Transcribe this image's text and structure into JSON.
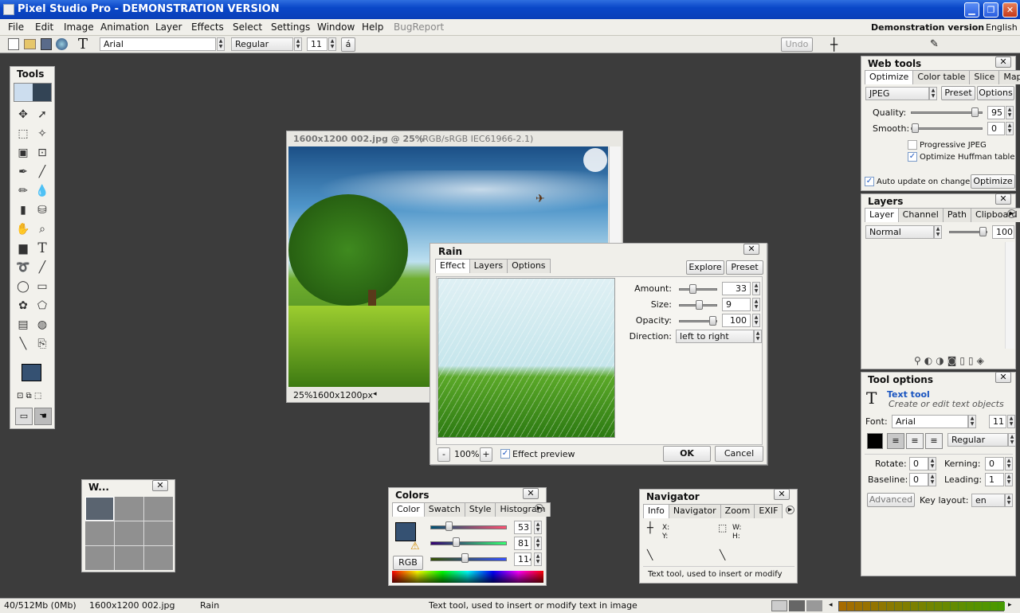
{
  "window": {
    "title": "Pixel Studio Pro - DEMONSTRATION VERSION",
    "minimize": "▁",
    "maximize": "❐",
    "close": "✕"
  },
  "menu": {
    "items": [
      "File",
      "Edit",
      "Image",
      "Animation",
      "Layer",
      "Effects",
      "Select",
      "Settings",
      "Window",
      "Help",
      "BugReport"
    ],
    "demo_label": "Demonstration version",
    "language": "English"
  },
  "toolbar": {
    "font": "Arial",
    "style": "Regular",
    "size": "11",
    "glyph": "á",
    "undo": "Undo"
  },
  "tools": {
    "title": "Tools"
  },
  "image_window": {
    "title": "1600x1200 002.jpg @ 25%",
    "profile": "(RGB/sRGB IEC61966-2.1)",
    "zoom": "25%",
    "size": "1600x1200px"
  },
  "rain": {
    "title": "Rain",
    "tabs": [
      "Effect",
      "Layers",
      "Options"
    ],
    "explore": "Explore",
    "preset": "Preset",
    "params": [
      {
        "label": "Amount:",
        "value": "33",
        "level": 0.33
      },
      {
        "label": "Size:",
        "value": "9",
        "level": 0.55
      },
      {
        "label": "Opacity:",
        "value": "100",
        "level": 1.0
      }
    ],
    "direction_label": "Direction:",
    "direction_value": "left to right",
    "zoom_minus": "-",
    "zoom": "100%",
    "zoom_plus": "+",
    "preview_label": "Effect preview",
    "ok": "OK",
    "cancel": "Cancel"
  },
  "web_tools": {
    "title": "Web tools",
    "tabs": [
      "Optimize",
      "Color table",
      "Slice",
      "Map"
    ],
    "format": "JPEG",
    "preset": "Preset",
    "options": "Options",
    "quality_label": "Quality:",
    "quality": "95",
    "quality_level": 0.95,
    "smooth_label": "Smooth:",
    "smooth": "0",
    "smooth_level": 0.0,
    "progressive": "Progressive JPEG",
    "huffman": "Optimize Huffman table",
    "auto_update": "Auto update on change",
    "optimize_btn": "Optimize"
  },
  "layers": {
    "title": "Layers",
    "tabs": [
      "Layer",
      "Channel",
      "Path",
      "Clipboard"
    ],
    "mode": "Normal",
    "opacity": "100",
    "opacity_level": 1.0
  },
  "tool_options": {
    "title": "Tool options",
    "tool_name": "Text tool",
    "tool_desc": "Create or edit text objects",
    "font_label": "Font:",
    "font": "Arial",
    "size": "11",
    "style": "Regular",
    "rotate_label": "Rotate:",
    "rotate": "0",
    "kerning_label": "Kerning:",
    "kerning": "0",
    "baseline_label": "Baseline:",
    "baseline": "0",
    "leading_label": "Leading:",
    "leading": "1",
    "advanced": "Advanced",
    "key_layout_label": "Key layout:",
    "key_layout": "en"
  },
  "w_panel": {
    "title": "W..."
  },
  "colors": {
    "title": "Colors",
    "tabs": [
      "Color",
      "Swatch",
      "Style",
      "Histogram"
    ],
    "r": "53",
    "g": "81",
    "b": "114",
    "r_level": 0.21,
    "g_level": 0.32,
    "b_level": 0.45,
    "mode": "RGB",
    "fg_color": "#355172"
  },
  "navigator": {
    "title": "Navigator",
    "tabs": [
      "Info",
      "Navigator",
      "Zoom",
      "EXIF"
    ],
    "x": "X:",
    "y": "Y:",
    "w": "W:",
    "h": "H:",
    "hint": "Text tool, used to insert or modify"
  },
  "status": {
    "memory": "40/512Mb (0Mb)",
    "file": "1600x1200 002.jpg",
    "effect": "Rain",
    "hint": "Text tool, used to insert or modify text in image"
  },
  "colors_palette": {
    "accent": "#0a47c8",
    "workspace": "#3c3c3c",
    "link": "#1a55c0"
  }
}
